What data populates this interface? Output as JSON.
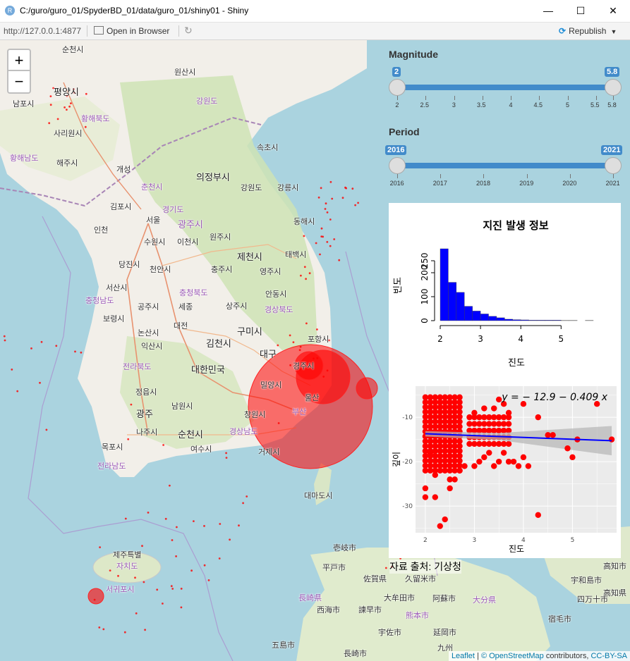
{
  "window": {
    "title": "C:/guro/guro_01/SpyderBD_01/data/guro_01/shiny01 - Shiny",
    "minimize": "—",
    "maximize": "☐",
    "close": "✕"
  },
  "toolbar": {
    "url": "http://127.0.0.1:4877",
    "open_browser": "Open in Browser",
    "publish": "Republish"
  },
  "map": {
    "zoom_in": "+",
    "zoom_out": "−",
    "labels": [
      "순천시",
      "원산시",
      "평양시",
      "남포시",
      "황해북도",
      "강원도",
      "사리원시",
      "황해남도",
      "해주시",
      "개성",
      "속초시",
      "의정부시",
      "춘천시",
      "강원도",
      "강릉시",
      "김포시",
      "경기도",
      "서울",
      "광주시",
      "인천",
      "수원시",
      "이천시",
      "원주시",
      "동해시",
      "당진시",
      "천안시",
      "제천시",
      "태백시",
      "충주시",
      "영주시",
      "서산시",
      "충청북도",
      "안동시",
      "충청남도",
      "공주시",
      "세종",
      "상주시",
      "경상북도",
      "보령시",
      "대전",
      "논산시",
      "구미시",
      "포항시",
      "익산시",
      "김천시",
      "대구",
      "전라북도",
      "대한민국",
      "경주시",
      "밀양시",
      "울산",
      "정읍시",
      "남원시",
      "광주",
      "창원시",
      "부산",
      "나주시",
      "순천시",
      "경상남도",
      "목포시",
      "여수시",
      "거제시",
      "전라남도",
      "대마도시",
      "제주특별",
      "자치도",
      "서귀포시",
      "壱岐市",
      "平戸市",
      "佐賀県",
      "久留米市",
      "長崎県",
      "西海市",
      "諫早市",
      "大牟田市",
      "熊本市",
      "阿蘇市",
      "大分県",
      "宇佐市",
      "延岡市",
      "九州",
      "五島市",
      "長崎市",
      "高知市",
      "宇和島市",
      "四万十市",
      "宿毛市",
      "高知県"
    ],
    "attribution_leaflet": "Leaflet",
    "attribution_osm": "© OpenStreetMap",
    "attribution_rest": "contributors,",
    "attribution_cc": "CC-BY-SA"
  },
  "controls": {
    "magnitude": {
      "label": "Magnitude",
      "min_value": "2",
      "max_value": "5.8",
      "ticks": [
        "2",
        "2.5",
        "3",
        "3.5",
        "4",
        "4.5",
        "5",
        "5.5",
        "5.8"
      ]
    },
    "period": {
      "label": "Period",
      "min_value": "2016",
      "max_value": "2021",
      "ticks": [
        "2016",
        "2017",
        "2018",
        "2019",
        "2020",
        "2021"
      ]
    }
  },
  "chart_data": [
    {
      "type": "bar",
      "title": "지진 발생 정보",
      "xlabel": "진도",
      "ylabel": "빈도",
      "x_ticks": [
        "2",
        "3",
        "4",
        "5"
      ],
      "y_ticks": [
        "0",
        "100",
        "200",
        "250"
      ],
      "bin_width": 0.2,
      "bins_start": [
        2.0,
        2.2,
        2.4,
        2.6,
        2.8,
        3.0,
        3.2,
        3.4,
        3.6,
        3.8,
        4.0,
        4.2,
        4.4,
        4.6,
        4.8,
        5.0,
        5.2,
        5.4,
        5.6
      ],
      "values": [
        300,
        160,
        118,
        60,
        40,
        28,
        18,
        12,
        6,
        4,
        3,
        2,
        2,
        2,
        2,
        1,
        1,
        0,
        1
      ],
      "ylim": [
        0,
        300
      ],
      "xlim": [
        2,
        5.8
      ],
      "colors": {
        "bar": "#0000ff"
      }
    },
    {
      "type": "scatter",
      "xlabel": "진도",
      "ylabel": "깊이",
      "equation": "y = − 12.9 − 0.409  x",
      "x_ticks": [
        "2",
        "3",
        "4",
        "5"
      ],
      "y_ticks": [
        "-10",
        "-20",
        "-30"
      ],
      "xlim": [
        1.8,
        5.9
      ],
      "ylim": [
        -36,
        -3
      ],
      "fit": {
        "intercept": -12.9,
        "slope": -0.409
      },
      "points": [
        [
          2.0,
          -26
        ],
        [
          2.0,
          -28
        ],
        [
          2.2,
          -28
        ],
        [
          2.3,
          -34.5
        ],
        [
          2.4,
          -33
        ],
        [
          2.5,
          -26
        ],
        [
          2.6,
          -24
        ],
        [
          2.7,
          -22
        ],
        [
          2.8,
          -21
        ],
        [
          3.0,
          -21
        ],
        [
          3.1,
          -20
        ],
        [
          3.2,
          -19
        ],
        [
          3.3,
          -18
        ],
        [
          3.4,
          -21
        ],
        [
          3.5,
          -20
        ],
        [
          3.6,
          -18
        ],
        [
          3.7,
          -20
        ],
        [
          3.8,
          -20
        ],
        [
          3.9,
          -21
        ],
        [
          4.0,
          -19
        ],
        [
          4.1,
          -21
        ],
        [
          3.0,
          -9
        ],
        [
          3.2,
          -8
        ],
        [
          3.4,
          -8
        ],
        [
          3.5,
          -6
        ],
        [
          3.6,
          -7
        ],
        [
          3.7,
          -9
        ],
        [
          4.0,
          -7
        ],
        [
          4.3,
          -10
        ],
        [
          4.3,
          -32
        ],
        [
          4.5,
          -14
        ],
        [
          4.6,
          -14
        ],
        [
          4.9,
          -17
        ],
        [
          5.0,
          -19
        ],
        [
          5.1,
          -15
        ],
        [
          5.5,
          -7
        ],
        [
          5.8,
          -15
        ],
        [
          2.1,
          -18
        ],
        [
          2.5,
          -24
        ],
        [
          2.2,
          -23
        ]
      ],
      "colors": {
        "points": "#ff0000",
        "fit": "#0000ff",
        "band": "#b5b5b5",
        "panel": "#ebebeb"
      }
    }
  ],
  "source_note": "자료 출처: 기상청"
}
